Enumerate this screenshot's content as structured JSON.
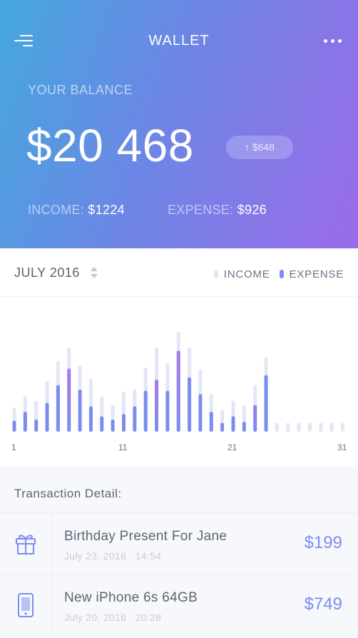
{
  "header": {
    "title": "WALLET",
    "menu_icon": "hamburger-menu-icon",
    "more_icon": "more-dots-icon"
  },
  "balance": {
    "label": "YOUR BALANCE",
    "amount": "$20 468",
    "change": "↑ $648",
    "income_label": "INCOME:",
    "income_value": "$1224",
    "expense_label": "EXPENSE:",
    "expense_value": "$926"
  },
  "chart_header": {
    "month": "JULY 2016",
    "legend_income": "INCOME",
    "legend_expense": "EXPENSE"
  },
  "colors": {
    "income": "#e3e6f6",
    "expense": "#7b8cf0",
    "expense_peak": "#a57ae8",
    "gradient_start": "#44a8dd",
    "gradient_end": "#9a6be8"
  },
  "chart_data": {
    "type": "bar",
    "title": "",
    "xlabel": "",
    "ylabel": "",
    "x_ticks": [
      "1",
      "11",
      "21",
      "31"
    ],
    "categories": [
      1,
      2,
      3,
      4,
      5,
      6,
      7,
      8,
      9,
      10,
      11,
      12,
      13,
      14,
      15,
      16,
      17,
      18,
      19,
      20,
      21,
      22,
      23,
      24,
      25,
      26,
      27,
      28,
      29,
      30,
      31
    ],
    "series": [
      {
        "name": "INCOME",
        "values": [
          22,
          32,
          28,
          46,
          64,
          76,
          60,
          48,
          32,
          24,
          36,
          38,
          58,
          76,
          62,
          90,
          76,
          56,
          34,
          20,
          28,
          24,
          42,
          67,
          8,
          8,
          8,
          8,
          8,
          8,
          8
        ]
      },
      {
        "name": "EXPENSE",
        "values": [
          10,
          18,
          11,
          26,
          42,
          57,
          38,
          23,
          14,
          11,
          16,
          23,
          37,
          47,
          37,
          73,
          49,
          34,
          18,
          8,
          14,
          9,
          24,
          51,
          0,
          0,
          0,
          0,
          0,
          0,
          0
        ]
      }
    ],
    "highlight_expense_days": [
      6,
      14,
      16,
      23
    ],
    "ylim": [
      0,
      90
    ],
    "grid": false
  },
  "transactions": {
    "title": "Transaction Detail:",
    "items": [
      {
        "name": "Birthday Present For Jane",
        "date": "July 23. 2016",
        "time": "14:54",
        "amount": "$199",
        "icon": "gift-icon"
      },
      {
        "name": "New iPhone 6s 64GB",
        "date": "July 20. 2016",
        "time": "20:28",
        "amount": "$749",
        "icon": "smartphone-icon"
      }
    ]
  }
}
